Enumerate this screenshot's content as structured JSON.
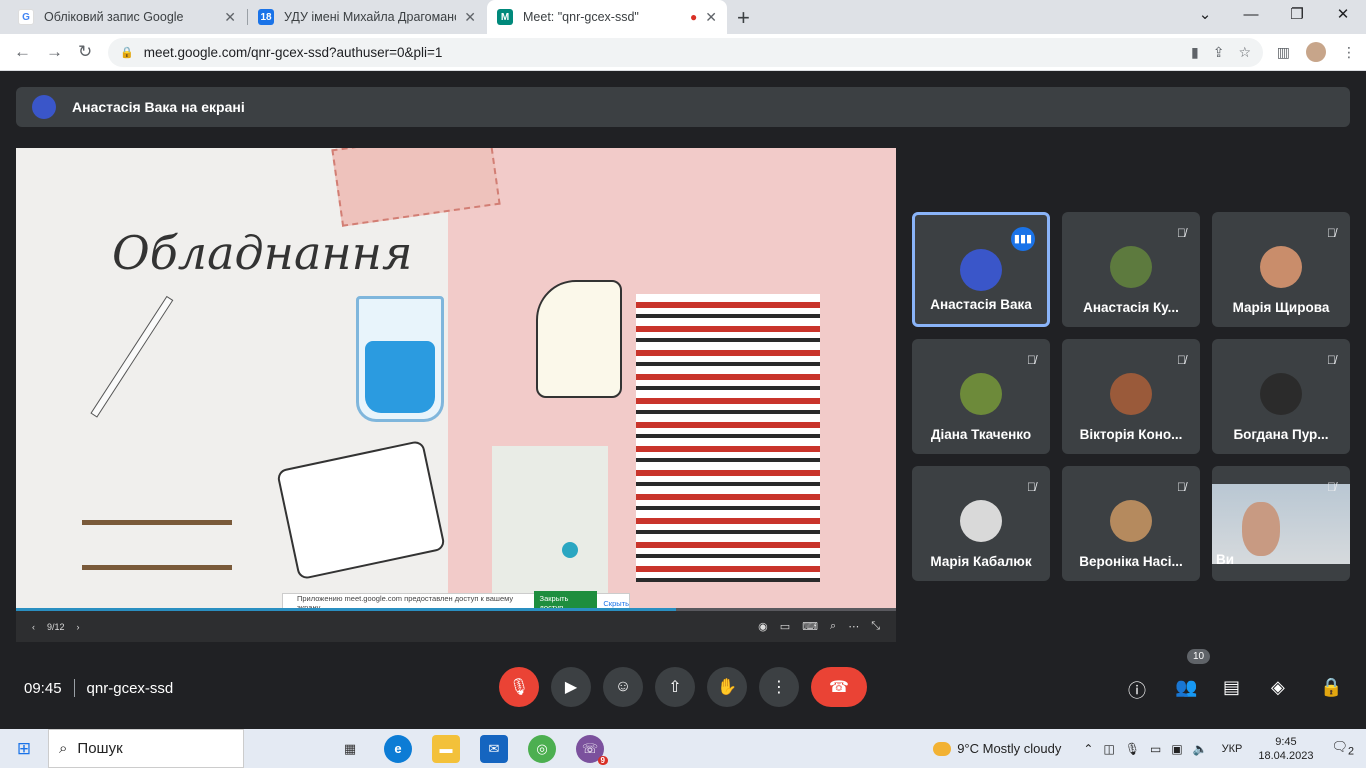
{
  "browser": {
    "tabs": [
      {
        "title": "Обліковий запис Google",
        "favicon": "G",
        "color": "#4285f4"
      },
      {
        "title": "УДУ імені Михайла Драгоманова",
        "favicon": "18",
        "color": "#1a73e8"
      },
      {
        "title": "Meet: \"qnr-gcex-ssd\"",
        "favicon": "M",
        "color": "#00897b"
      }
    ],
    "url": "meet.google.com/qnr-gcex-ssd?authuser=0&pli=1"
  },
  "meet": {
    "presenter_label": "Анастасія Вака на екрані",
    "slide": {
      "title": "Обладнання",
      "page": "9/12",
      "progress_fraction": 0.75,
      "share_notice": {
        "text": "Приложению meet.google.com предоставлен доступ к вашему экрану.",
        "stop": "Закрыть доступ",
        "hide": "Скрыть"
      }
    },
    "participants": [
      {
        "name": "Анастасія Вака",
        "speaking": true,
        "face": "#3a56c9"
      },
      {
        "name": "Анастасія Ку...",
        "speaking": false,
        "face": "#5d7a3e"
      },
      {
        "name": "Марія Щирова",
        "speaking": false,
        "face": "#c98d6b"
      },
      {
        "name": "Діана Ткаченко",
        "speaking": false,
        "face": "#6d8a3a"
      },
      {
        "name": "Вікторія Коно...",
        "speaking": false,
        "face": "#9a5a3a"
      },
      {
        "name": "Богдана Пур...",
        "speaking": false,
        "face": "#2b2b2b"
      },
      {
        "name": "Марія Кабалюк",
        "speaking": false,
        "face": "#d9d9d9"
      },
      {
        "name": "Вероніка Насі...",
        "speaking": false,
        "face": "#b58a5e"
      },
      {
        "name": "Ви",
        "speaking": false,
        "face": "#c89a82"
      }
    ],
    "time": "09:45",
    "meeting_code": "qnr-gcex-ssd",
    "participant_count": "10"
  },
  "taskbar": {
    "search_label": "Пошук",
    "weather": "9°C  Mostly cloudy",
    "lang": "УКР",
    "time": "9:45",
    "date": "18.04.2023",
    "viber_count": "9",
    "notif_count": "2"
  }
}
